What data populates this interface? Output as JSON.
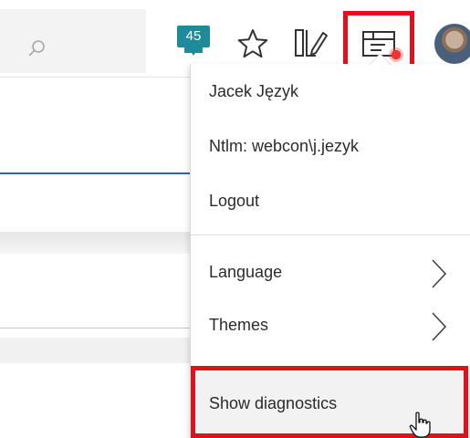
{
  "header": {
    "notification_count": "45"
  },
  "menu": {
    "user_name": "Jacek Język",
    "login": "Ntlm: webcon\\j.jezyk",
    "logout_label": "Logout",
    "language_label": "Language",
    "themes_label": "Themes",
    "show_diagnostics_label": "Show diagnostics"
  },
  "colors": {
    "accent_badge": "#1f8a9a",
    "highlight_red": "#e0111c",
    "link_blue": "#2f66b3"
  },
  "icons": [
    "search-icon",
    "notification-icon",
    "star-icon",
    "panel-edit-icon",
    "diagnostics-icon",
    "chevron-right-icon",
    "hand-cursor-icon"
  ]
}
